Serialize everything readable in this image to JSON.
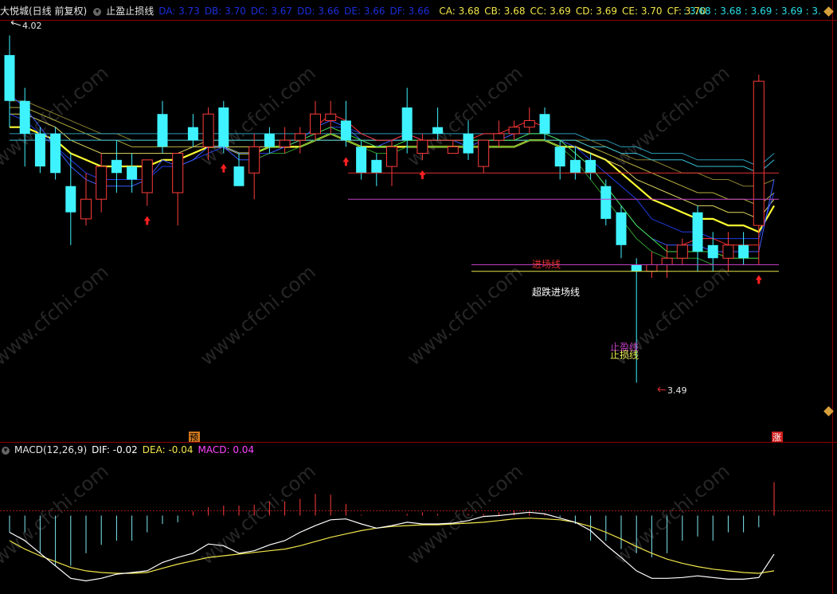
{
  "header": {
    "stock": "大悦城(日线 前复权)",
    "indicator": "止盈止损线",
    "dx_values": [
      {
        "label": "DA: 3.73",
        "color": "#1c2cdc"
      },
      {
        "label": "DB: 3.70",
        "color": "#1c2cdc"
      },
      {
        "label": "DC: 3.67",
        "color": "#1c2cdc"
      },
      {
        "label": "DD: 3.66",
        "color": "#1c2cdc"
      },
      {
        "label": "DE: 3.66",
        "color": "#1c2cdc"
      },
      {
        "label": "DF: 3.66",
        "color": "#1c2cdc"
      }
    ],
    "cx_values": [
      {
        "label": "CA: 3.68",
        "color": "#f2e64a"
      },
      {
        "label": "CB: 3.68",
        "color": "#f2e64a"
      },
      {
        "label": "CC: 3.69",
        "color": "#f2e64a"
      },
      {
        "label": "CD: 3.69",
        "color": "#f2e64a"
      },
      {
        "label": "CE: 3.70",
        "color": "#f2e64a"
      },
      {
        "label": "CF: 3.70",
        "color": "#f2e64a"
      }
    ],
    "right_values": ": 3.68 : 3.68 : 3.69 : 3.69 : 3.",
    "watermark": "www.cfchi.com"
  },
  "macd_header": {
    "title": "MACD(12,26,9)",
    "dif": "DIF: -0.02",
    "dea": "DEA: -0.04",
    "macd": "MACD: 0.04"
  },
  "labels": {
    "high_mark": "4.02",
    "low_mark": "3.49",
    "entry_line": "进场线",
    "oversold_entry": "超跌进场线",
    "take_profit": "止盈线",
    "stop_loss": "止损线",
    "badge_left": "预",
    "badge_right": "涨"
  },
  "colors": {
    "up": "#ff3b3b",
    "down": "#3ff2ff",
    "dif": "#ffffff",
    "dea": "#f2e64a",
    "macd_label": "#ff44ff",
    "entry_line": "#e03030",
    "oversold_line": "#c040c0",
    "take_profit_line": "#c040c0",
    "stop_loss_line": "#e6e64a"
  },
  "chart_data": {
    "type": "candlestick",
    "ylim": [
      3.43,
      4.04
    ],
    "levels": {
      "entry": 3.81,
      "oversold_entry": 3.77,
      "take_profit": 3.67,
      "stop_loss": 3.66
    },
    "candles": [
      {
        "o": 3.99,
        "h": 4.02,
        "l": 3.88,
        "c": 3.92
      },
      {
        "o": 3.92,
        "h": 3.94,
        "l": 3.82,
        "c": 3.87
      },
      {
        "o": 3.87,
        "h": 3.88,
        "l": 3.81,
        "c": 3.82
      },
      {
        "o": 3.87,
        "h": 3.88,
        "l": 3.8,
        "c": 3.81
      },
      {
        "o": 3.79,
        "h": 3.84,
        "l": 3.7,
        "c": 3.75
      },
      {
        "o": 3.74,
        "h": 3.81,
        "l": 3.73,
        "c": 3.77
      },
      {
        "o": 3.77,
        "h": 3.84,
        "l": 3.75,
        "c": 3.82
      },
      {
        "o": 3.83,
        "h": 3.86,
        "l": 3.78,
        "c": 3.81
      },
      {
        "o": 3.82,
        "h": 3.84,
        "l": 3.78,
        "c": 3.8
      },
      {
        "o": 3.78,
        "h": 3.83,
        "l": 3.76,
        "c": 3.83
      },
      {
        "o": 3.9,
        "h": 3.92,
        "l": 3.84,
        "c": 3.85
      },
      {
        "o": 3.78,
        "h": 3.84,
        "l": 3.73,
        "c": 3.84
      },
      {
        "o": 3.88,
        "h": 3.9,
        "l": 3.85,
        "c": 3.86
      },
      {
        "o": 3.85,
        "h": 3.91,
        "l": 3.83,
        "c": 3.9
      },
      {
        "o": 3.91,
        "h": 3.92,
        "l": 3.84,
        "c": 3.85
      },
      {
        "o": 3.82,
        "h": 3.84,
        "l": 3.79,
        "c": 3.79
      },
      {
        "o": 3.81,
        "h": 3.87,
        "l": 3.77,
        "c": 3.85
      },
      {
        "o": 3.87,
        "h": 3.88,
        "l": 3.84,
        "c": 3.85
      },
      {
        "o": 3.85,
        "h": 3.88,
        "l": 3.84,
        "c": 3.86
      },
      {
        "o": 3.86,
        "h": 3.88,
        "l": 3.84,
        "c": 3.87
      },
      {
        "o": 3.87,
        "h": 3.92,
        "l": 3.86,
        "c": 3.9
      },
      {
        "o": 3.89,
        "h": 3.92,
        "l": 3.87,
        "c": 3.9
      },
      {
        "o": 3.89,
        "h": 3.92,
        "l": 3.85,
        "c": 3.86
      },
      {
        "o": 3.85,
        "h": 3.86,
        "l": 3.8,
        "c": 3.81
      },
      {
        "o": 3.83,
        "h": 3.84,
        "l": 3.79,
        "c": 3.81
      },
      {
        "o": 3.82,
        "h": 3.86,
        "l": 3.79,
        "c": 3.85
      },
      {
        "o": 3.91,
        "h": 3.94,
        "l": 3.84,
        "c": 3.86
      },
      {
        "o": 3.84,
        "h": 3.87,
        "l": 3.83,
        "c": 3.86
      },
      {
        "o": 3.88,
        "h": 3.91,
        "l": 3.86,
        "c": 3.87
      },
      {
        "o": 3.84,
        "h": 3.86,
        "l": 3.84,
        "c": 3.85
      },
      {
        "o": 3.87,
        "h": 3.89,
        "l": 3.83,
        "c": 3.84
      },
      {
        "o": 3.82,
        "h": 3.86,
        "l": 3.81,
        "c": 3.86
      },
      {
        "o": 3.86,
        "h": 3.89,
        "l": 3.85,
        "c": 3.87
      },
      {
        "o": 3.87,
        "h": 3.89,
        "l": 3.86,
        "c": 3.88
      },
      {
        "o": 3.88,
        "h": 3.91,
        "l": 3.87,
        "c": 3.89
      },
      {
        "o": 3.9,
        "h": 3.91,
        "l": 3.86,
        "c": 3.87
      },
      {
        "o": 3.85,
        "h": 3.86,
        "l": 3.8,
        "c": 3.82
      },
      {
        "o": 3.83,
        "h": 3.85,
        "l": 3.8,
        "c": 3.81
      },
      {
        "o": 3.83,
        "h": 3.84,
        "l": 3.8,
        "c": 3.81
      },
      {
        "o": 3.79,
        "h": 3.8,
        "l": 3.73,
        "c": 3.74
      },
      {
        "o": 3.75,
        "h": 3.76,
        "l": 3.68,
        "c": 3.7
      },
      {
        "o": 3.67,
        "h": 3.68,
        "l": 3.49,
        "c": 3.66
      },
      {
        "o": 3.66,
        "h": 3.69,
        "l": 3.65,
        "c": 3.67
      },
      {
        "o": 3.67,
        "h": 3.7,
        "l": 3.65,
        "c": 3.68
      },
      {
        "o": 3.68,
        "h": 3.71,
        "l": 3.67,
        "c": 3.7
      },
      {
        "o": 3.75,
        "h": 3.76,
        "l": 3.66,
        "c": 3.69
      },
      {
        "o": 3.7,
        "h": 3.72,
        "l": 3.66,
        "c": 3.68
      },
      {
        "o": 3.68,
        "h": 3.72,
        "l": 3.66,
        "c": 3.7
      },
      {
        "o": 3.7,
        "h": 3.72,
        "l": 3.67,
        "c": 3.68
      },
      {
        "o": 3.73,
        "h": 3.96,
        "l": 3.67,
        "c": 3.95
      }
    ],
    "buy_arrows": [
      9,
      14,
      22,
      27,
      50
    ],
    "ma_bands": [
      {
        "color": "#ffff33",
        "width": 2.2,
        "values": [
          3.88,
          3.88,
          3.87,
          3.86,
          3.84,
          3.83,
          3.82,
          3.82,
          3.82,
          3.82,
          3.83,
          3.83,
          3.84,
          3.85,
          3.85,
          3.84,
          3.84,
          3.85,
          3.85,
          3.85,
          3.86,
          3.87,
          3.86,
          3.85,
          3.85,
          3.85,
          3.85,
          3.85,
          3.85,
          3.85,
          3.85,
          3.85,
          3.85,
          3.85,
          3.86,
          3.86,
          3.85,
          3.85,
          3.84,
          3.83,
          3.81,
          3.79,
          3.77,
          3.76,
          3.75,
          3.74,
          3.74,
          3.73,
          3.73,
          3.72,
          3.76
        ]
      },
      {
        "color": "#e0d860",
        "width": 1,
        "values": [
          3.9,
          3.9,
          3.89,
          3.88,
          3.86,
          3.85,
          3.84,
          3.84,
          3.84,
          3.84,
          3.84,
          3.84,
          3.85,
          3.85,
          3.85,
          3.85,
          3.85,
          3.85,
          3.85,
          3.86,
          3.86,
          3.86,
          3.86,
          3.86,
          3.86,
          3.86,
          3.86,
          3.86,
          3.86,
          3.86,
          3.86,
          3.86,
          3.86,
          3.86,
          3.86,
          3.86,
          3.86,
          3.85,
          3.84,
          3.83,
          3.82,
          3.8,
          3.79,
          3.78,
          3.77,
          3.76,
          3.76,
          3.75,
          3.75,
          3.74,
          3.77
        ]
      },
      {
        "color": "#b8b040",
        "width": 1,
        "values": [
          3.91,
          3.91,
          3.9,
          3.89,
          3.88,
          3.87,
          3.86,
          3.86,
          3.85,
          3.85,
          3.85,
          3.85,
          3.85,
          3.86,
          3.86,
          3.86,
          3.86,
          3.86,
          3.86,
          3.86,
          3.86,
          3.86,
          3.86,
          3.86,
          3.86,
          3.86,
          3.86,
          3.86,
          3.86,
          3.86,
          3.86,
          3.86,
          3.86,
          3.86,
          3.86,
          3.86,
          3.86,
          3.86,
          3.85,
          3.84,
          3.83,
          3.82,
          3.81,
          3.8,
          3.79,
          3.78,
          3.78,
          3.77,
          3.77,
          3.76,
          3.78
        ]
      },
      {
        "color": "#8a8030",
        "width": 1,
        "values": [
          3.92,
          3.92,
          3.91,
          3.9,
          3.89,
          3.88,
          3.87,
          3.87,
          3.86,
          3.86,
          3.86,
          3.86,
          3.86,
          3.86,
          3.86,
          3.86,
          3.86,
          3.86,
          3.86,
          3.86,
          3.86,
          3.86,
          3.86,
          3.86,
          3.86,
          3.86,
          3.86,
          3.86,
          3.86,
          3.86,
          3.86,
          3.86,
          3.86,
          3.86,
          3.86,
          3.86,
          3.86,
          3.86,
          3.86,
          3.85,
          3.84,
          3.83,
          3.83,
          3.82,
          3.81,
          3.81,
          3.8,
          3.8,
          3.79,
          3.79,
          3.8
        ]
      },
      {
        "color": "#1f3ee8",
        "width": 1,
        "values": [
          3.9,
          3.89,
          3.87,
          3.85,
          3.83,
          3.81,
          3.8,
          3.8,
          3.8,
          3.8,
          3.82,
          3.82,
          3.83,
          3.84,
          3.85,
          3.84,
          3.84,
          3.84,
          3.85,
          3.86,
          3.87,
          3.88,
          3.88,
          3.87,
          3.86,
          3.86,
          3.86,
          3.86,
          3.86,
          3.86,
          3.86,
          3.86,
          3.86,
          3.86,
          3.87,
          3.87,
          3.86,
          3.85,
          3.83,
          3.81,
          3.79,
          3.77,
          3.74,
          3.73,
          3.72,
          3.72,
          3.71,
          3.71,
          3.71,
          3.71,
          3.78
        ]
      },
      {
        "color": "#3b5cff",
        "width": 1,
        "values": [
          3.93,
          3.91,
          3.88,
          3.85,
          3.82,
          3.8,
          3.79,
          3.79,
          3.79,
          3.8,
          3.83,
          3.82,
          3.83,
          3.85,
          3.85,
          3.83,
          3.83,
          3.84,
          3.85,
          3.86,
          3.88,
          3.89,
          3.88,
          3.86,
          3.85,
          3.86,
          3.87,
          3.86,
          3.86,
          3.86,
          3.85,
          3.86,
          3.86,
          3.87,
          3.87,
          3.87,
          3.86,
          3.84,
          3.82,
          3.79,
          3.76,
          3.73,
          3.71,
          3.7,
          3.7,
          3.7,
          3.69,
          3.69,
          3.69,
          3.69,
          3.8
        ]
      },
      {
        "color": "#38c0d8",
        "width": 1,
        "values": [
          3.86,
          3.86,
          3.86,
          3.86,
          3.86,
          3.86,
          3.86,
          3.86,
          3.86,
          3.86,
          3.86,
          3.86,
          3.86,
          3.86,
          3.86,
          3.86,
          3.86,
          3.86,
          3.86,
          3.86,
          3.86,
          3.86,
          3.86,
          3.86,
          3.86,
          3.86,
          3.86,
          3.86,
          3.86,
          3.86,
          3.86,
          3.86,
          3.86,
          3.86,
          3.86,
          3.86,
          3.86,
          3.86,
          3.85,
          3.85,
          3.84,
          3.84,
          3.83,
          3.83,
          3.83,
          3.82,
          3.82,
          3.82,
          3.82,
          3.81,
          3.83
        ]
      },
      {
        "color": "#2a9cb8",
        "width": 1,
        "values": [
          3.87,
          3.87,
          3.87,
          3.87,
          3.87,
          3.87,
          3.87,
          3.87,
          3.87,
          3.87,
          3.87,
          3.87,
          3.87,
          3.87,
          3.87,
          3.87,
          3.87,
          3.87,
          3.87,
          3.87,
          3.87,
          3.87,
          3.87,
          3.87,
          3.87,
          3.87,
          3.87,
          3.87,
          3.87,
          3.87,
          3.87,
          3.87,
          3.87,
          3.87,
          3.87,
          3.87,
          3.87,
          3.87,
          3.86,
          3.86,
          3.85,
          3.85,
          3.84,
          3.84,
          3.84,
          3.83,
          3.83,
          3.83,
          3.83,
          3.82,
          3.84
        ]
      },
      {
        "color": "#44dd44",
        "width": 1,
        "values": [
          null,
          null,
          null,
          null,
          null,
          null,
          null,
          null,
          null,
          null,
          null,
          null,
          null,
          null,
          null,
          null,
          3.84,
          3.85,
          3.85,
          3.86,
          3.87,
          3.88,
          3.87,
          3.86,
          3.85,
          3.85,
          3.86,
          3.86,
          3.86,
          3.86,
          3.86,
          3.86,
          3.86,
          3.86,
          3.87,
          3.87,
          3.86,
          3.84,
          3.82,
          3.79,
          3.76,
          3.73,
          3.71,
          3.69,
          3.69,
          3.69,
          3.69,
          3.68,
          3.68,
          3.68,
          null
        ]
      },
      {
        "color": "#2f9a2f",
        "width": 1,
        "values": [
          null,
          null,
          null,
          null,
          null,
          null,
          null,
          null,
          null,
          null,
          null,
          null,
          null,
          null,
          null,
          null,
          3.83,
          3.84,
          3.84,
          3.85,
          3.86,
          3.87,
          3.86,
          3.85,
          3.84,
          3.84,
          3.85,
          3.85,
          3.85,
          3.85,
          3.85,
          3.85,
          3.85,
          3.85,
          3.86,
          3.86,
          3.85,
          3.83,
          3.8,
          3.77,
          3.74,
          3.71,
          3.69,
          3.68,
          3.68,
          3.68,
          3.67,
          3.67,
          3.67,
          3.67,
          null
        ]
      },
      {
        "color": "#ff3030",
        "width": 1,
        "values": [
          null,
          null,
          null,
          null,
          null,
          null,
          null,
          null,
          null,
          null,
          null,
          null,
          null,
          null,
          null,
          null,
          null,
          null,
          null,
          null,
          3.88,
          3.9,
          3.89,
          3.87,
          3.86,
          3.86,
          3.87,
          3.86,
          3.86,
          3.86,
          3.86,
          3.87,
          3.87,
          3.88,
          3.89,
          3.88,
          null,
          null,
          null,
          null,
          null,
          null,
          null,
          null,
          3.7,
          3.71,
          3.71,
          3.7,
          3.7,
          3.7,
          null
        ]
      }
    ],
    "macd": {
      "ylim": [
        -0.088,
        0.069
      ],
      "dif": [
        -0.02,
        -0.03,
        -0.045,
        -0.06,
        -0.075,
        -0.078,
        -0.075,
        -0.07,
        -0.068,
        -0.066,
        -0.056,
        -0.05,
        -0.045,
        -0.034,
        -0.036,
        -0.045,
        -0.042,
        -0.035,
        -0.03,
        -0.02,
        -0.012,
        -0.005,
        -0.004,
        -0.01,
        -0.015,
        -0.012,
        -0.008,
        -0.01,
        -0.01,
        -0.009,
        -0.006,
        -0.001,
        0.0,
        0.002,
        0.004,
        0.002,
        -0.003,
        -0.008,
        -0.018,
        -0.035,
        -0.05,
        -0.066,
        -0.075,
        -0.075,
        -0.074,
        -0.072,
        -0.074,
        -0.076,
        -0.076,
        -0.074,
        -0.046
      ],
      "dea": [
        -0.03,
        -0.04,
        -0.048,
        -0.055,
        -0.062,
        -0.066,
        -0.068,
        -0.069,
        -0.069,
        -0.068,
        -0.063,
        -0.058,
        -0.054,
        -0.05,
        -0.048,
        -0.046,
        -0.044,
        -0.042,
        -0.04,
        -0.036,
        -0.031,
        -0.026,
        -0.022,
        -0.018,
        -0.015,
        -0.013,
        -0.012,
        -0.011,
        -0.011,
        -0.01,
        -0.009,
        -0.008,
        -0.006,
        -0.004,
        -0.003,
        -0.004,
        -0.005,
        -0.008,
        -0.013,
        -0.02,
        -0.028,
        -0.037,
        -0.045,
        -0.052,
        -0.057,
        -0.061,
        -0.064,
        -0.066,
        -0.068,
        -0.069,
        -0.066
      ],
      "hist": [
        -0.02,
        -0.02,
        -0.045,
        -0.06,
        -0.06,
        -0.045,
        -0.035,
        -0.03,
        -0.03,
        -0.02,
        -0.01,
        -0.008,
        0.005,
        0.01,
        0.012,
        0.012,
        0.013,
        0.017,
        0.017,
        0.02,
        0.026,
        0.025,
        0.014,
        0.001,
        0.0,
        0.0,
        0.002,
        0.004,
        0.002,
        0.0,
        0.002,
        0.002,
        0.004,
        0.006,
        0.004,
        0.002,
        -0.002,
        -0.01,
        -0.03,
        -0.03,
        -0.04,
        -0.045,
        -0.05,
        -0.045,
        -0.03,
        -0.025,
        -0.03,
        -0.02,
        -0.02,
        -0.014,
        0.04
      ]
    }
  }
}
